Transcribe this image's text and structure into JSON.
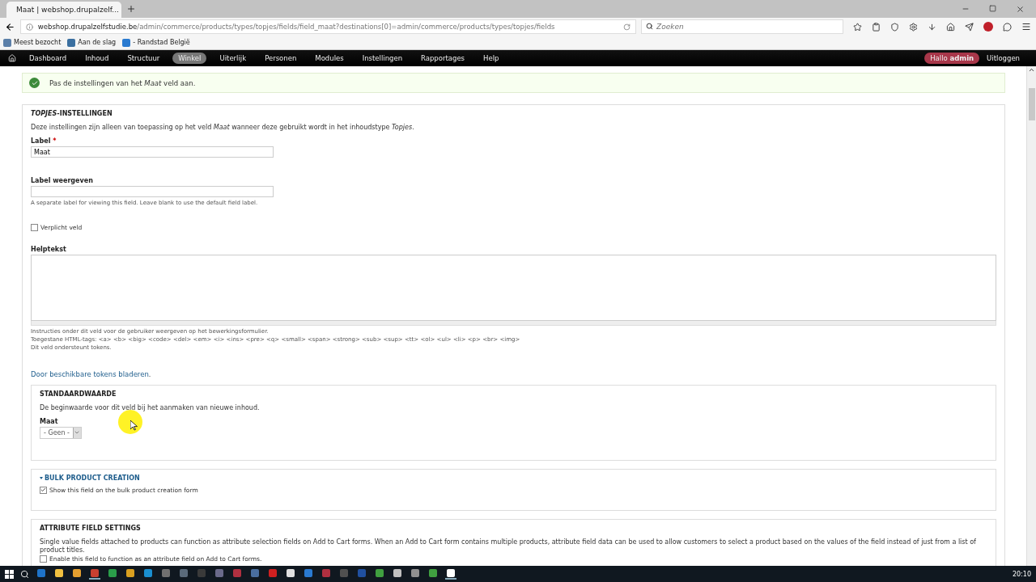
{
  "browser": {
    "tab_title": "Maat | webshop.drupalzelf...",
    "url_domain": "webshop.drupalzelfstudie.be",
    "url_path": "/admin/commerce/products/types/topjes/fields/field_maat?destinations[0]=admin/commerce/products/types/topjes/fields",
    "search": {
      "placeholder": "Zoeken"
    },
    "bookmarks": [
      "Meest bezocht",
      "Aan de slag",
      "- Randstad België"
    ]
  },
  "admin_menu": {
    "items": [
      {
        "label": "Dashboard",
        "selected": false
      },
      {
        "label": "Inhoud",
        "selected": false
      },
      {
        "label": "Structuur",
        "selected": false
      },
      {
        "label": "Winkel",
        "selected": true
      },
      {
        "label": "Uiterlijk",
        "selected": false
      },
      {
        "label": "Personen",
        "selected": false
      },
      {
        "label": "Modules",
        "selected": false
      },
      {
        "label": "Instellingen",
        "selected": false
      },
      {
        "label": "Rapportages",
        "selected": false
      },
      {
        "label": "Help",
        "selected": false
      }
    ],
    "greeting": "Hallo **admin**",
    "logout": "Uitloggen"
  },
  "message": "Pas de instellingen van het *Maat* veld aan.",
  "settings": {
    "title": "*TOPJES*-INSTELLINGEN",
    "description": "Deze instellingen zijn alleen van toepassing op het veld *Maat* wanneer deze gebruikt wordt in het inhoudstype *Topjes*.",
    "label_field": {
      "label": "Label",
      "required_mark": "*",
      "value": "Maat"
    },
    "display_label_field": {
      "label": "Label weergeven",
      "description": "A separate label for viewing this field. Leave blank to use the default field label."
    },
    "required_checkbox": {
      "label": "Verplicht veld",
      "checked": false
    },
    "help_text": {
      "label": "Helptekst",
      "descriptions": [
        "Instructies onder dit veld voor de gebruiker weergeven op het bewerkingsformulier.",
        "Toegestane HTML-tags: <a> <b> <big> <code> <del> <em> <i> <ins> <pre> <q> <small> <span> <strong> <sub> <sup> <tt> <ol> <ul> <li> <p> <br> <img>",
        "Dit veld ondersteunt tokens."
      ]
    },
    "tokens_link": "Door beschikbare tokens bladeren",
    "tokens_link_suffix": ".",
    "default_value": {
      "title": "STANDAARDWAARDE",
      "description": "De beginwaarde voor dit veld bij het aanmaken van nieuwe inhoud.",
      "select_label": "Maat",
      "select_value": "- Geen -"
    },
    "bulk": {
      "title": "BULK PRODUCT CREATION",
      "expanded": true,
      "checkbox": {
        "label": "Show this field on the bulk product creation form",
        "checked": true
      }
    },
    "attribute": {
      "title": "ATTRIBUTE FIELD SETTINGS",
      "description": "Single value fields attached to products can function as attribute selection fields on Add to Cart forms. When an Add to Cart form contains multiple products, attribute field data can be used to allow customers to select a product based on the values of the field instead of just from a list of product titles.",
      "checkbox": {
        "label": "Enable this field to function as an attribute field on Add to Cart forms.",
        "checked": false
      }
    }
  },
  "taskbar": {
    "apps": [
      {
        "color": "#1e73c8",
        "selected": false
      },
      {
        "color": "#f0c040",
        "selected": false
      },
      {
        "color": "#e5a030",
        "selected": false
      },
      {
        "color": "#c84030",
        "selected": true
      },
      {
        "color": "#2a9d4a",
        "selected": false
      },
      {
        "color": "#d9a020",
        "selected": false
      },
      {
        "color": "#1a8fd0",
        "selected": false
      },
      {
        "color": "#707070",
        "selected": false
      },
      {
        "color": "#5a6a7a",
        "selected": false
      },
      {
        "color": "#3a3a3a",
        "selected": false
      },
      {
        "color": "#6a6a8a",
        "selected": false
      },
      {
        "color": "#b03040",
        "selected": false
      },
      {
        "color": "#4a6fa0",
        "selected": false
      },
      {
        "color": "#d02020",
        "selected": false
      },
      {
        "color": "#e0e0e0",
        "selected": false
      },
      {
        "color": "#2a7ad0",
        "selected": false
      },
      {
        "color": "#b03040",
        "selected": false
      },
      {
        "color": "#505050",
        "selected": false
      },
      {
        "color": "#2050a0",
        "selected": false
      },
      {
        "color": "#40a040",
        "selected": false
      },
      {
        "color": "#c0c0c0",
        "selected": false
      },
      {
        "color": "#909090",
        "selected": false
      },
      {
        "color": "#40a040",
        "selected": false
      },
      {
        "color": "#ffffff",
        "selected": true
      }
    ],
    "clock": "20:10"
  }
}
